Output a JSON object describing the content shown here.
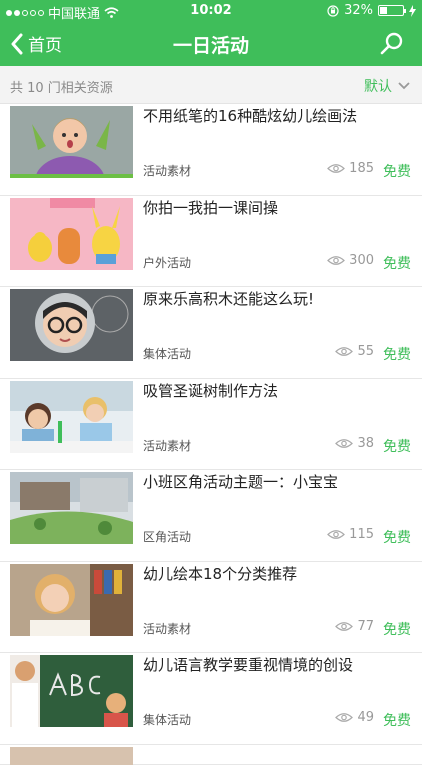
{
  "status": {
    "carrier": "中国联通",
    "time": "10:02",
    "battery": "32%",
    "battery_level": 0.32
  },
  "nav": {
    "back_label": "首页",
    "title": "一日活动"
  },
  "filter": {
    "count_text": "共 10 门相关资源",
    "sort_label": "默认"
  },
  "colors": {
    "brand": "#3fbe5a",
    "price": "#3fbe5a"
  },
  "items": [
    {
      "title": "不用纸笔的16种酷炫幼儿绘画法",
      "category": "活动素材",
      "views": "185",
      "price": "免费"
    },
    {
      "title": "你拍一我拍一课间操",
      "category": "户外活动",
      "views": "300",
      "price": "免费"
    },
    {
      "title": "原来乐高积木还能这么玩!",
      "category": "集体活动",
      "views": "55",
      "price": "免费"
    },
    {
      "title": "吸管圣诞树制作方法",
      "category": "活动素材",
      "views": "38",
      "price": "免费"
    },
    {
      "title": "小班区角活动主题一：小宝宝",
      "category": "区角活动",
      "views": "115",
      "price": "免费"
    },
    {
      "title": "幼儿绘本18个分类推荐",
      "category": "活动素材",
      "views": "77",
      "price": "免费"
    },
    {
      "title": "幼儿语言教学要重视情境的创设",
      "category": "集体活动",
      "views": "49",
      "price": "免费"
    }
  ]
}
